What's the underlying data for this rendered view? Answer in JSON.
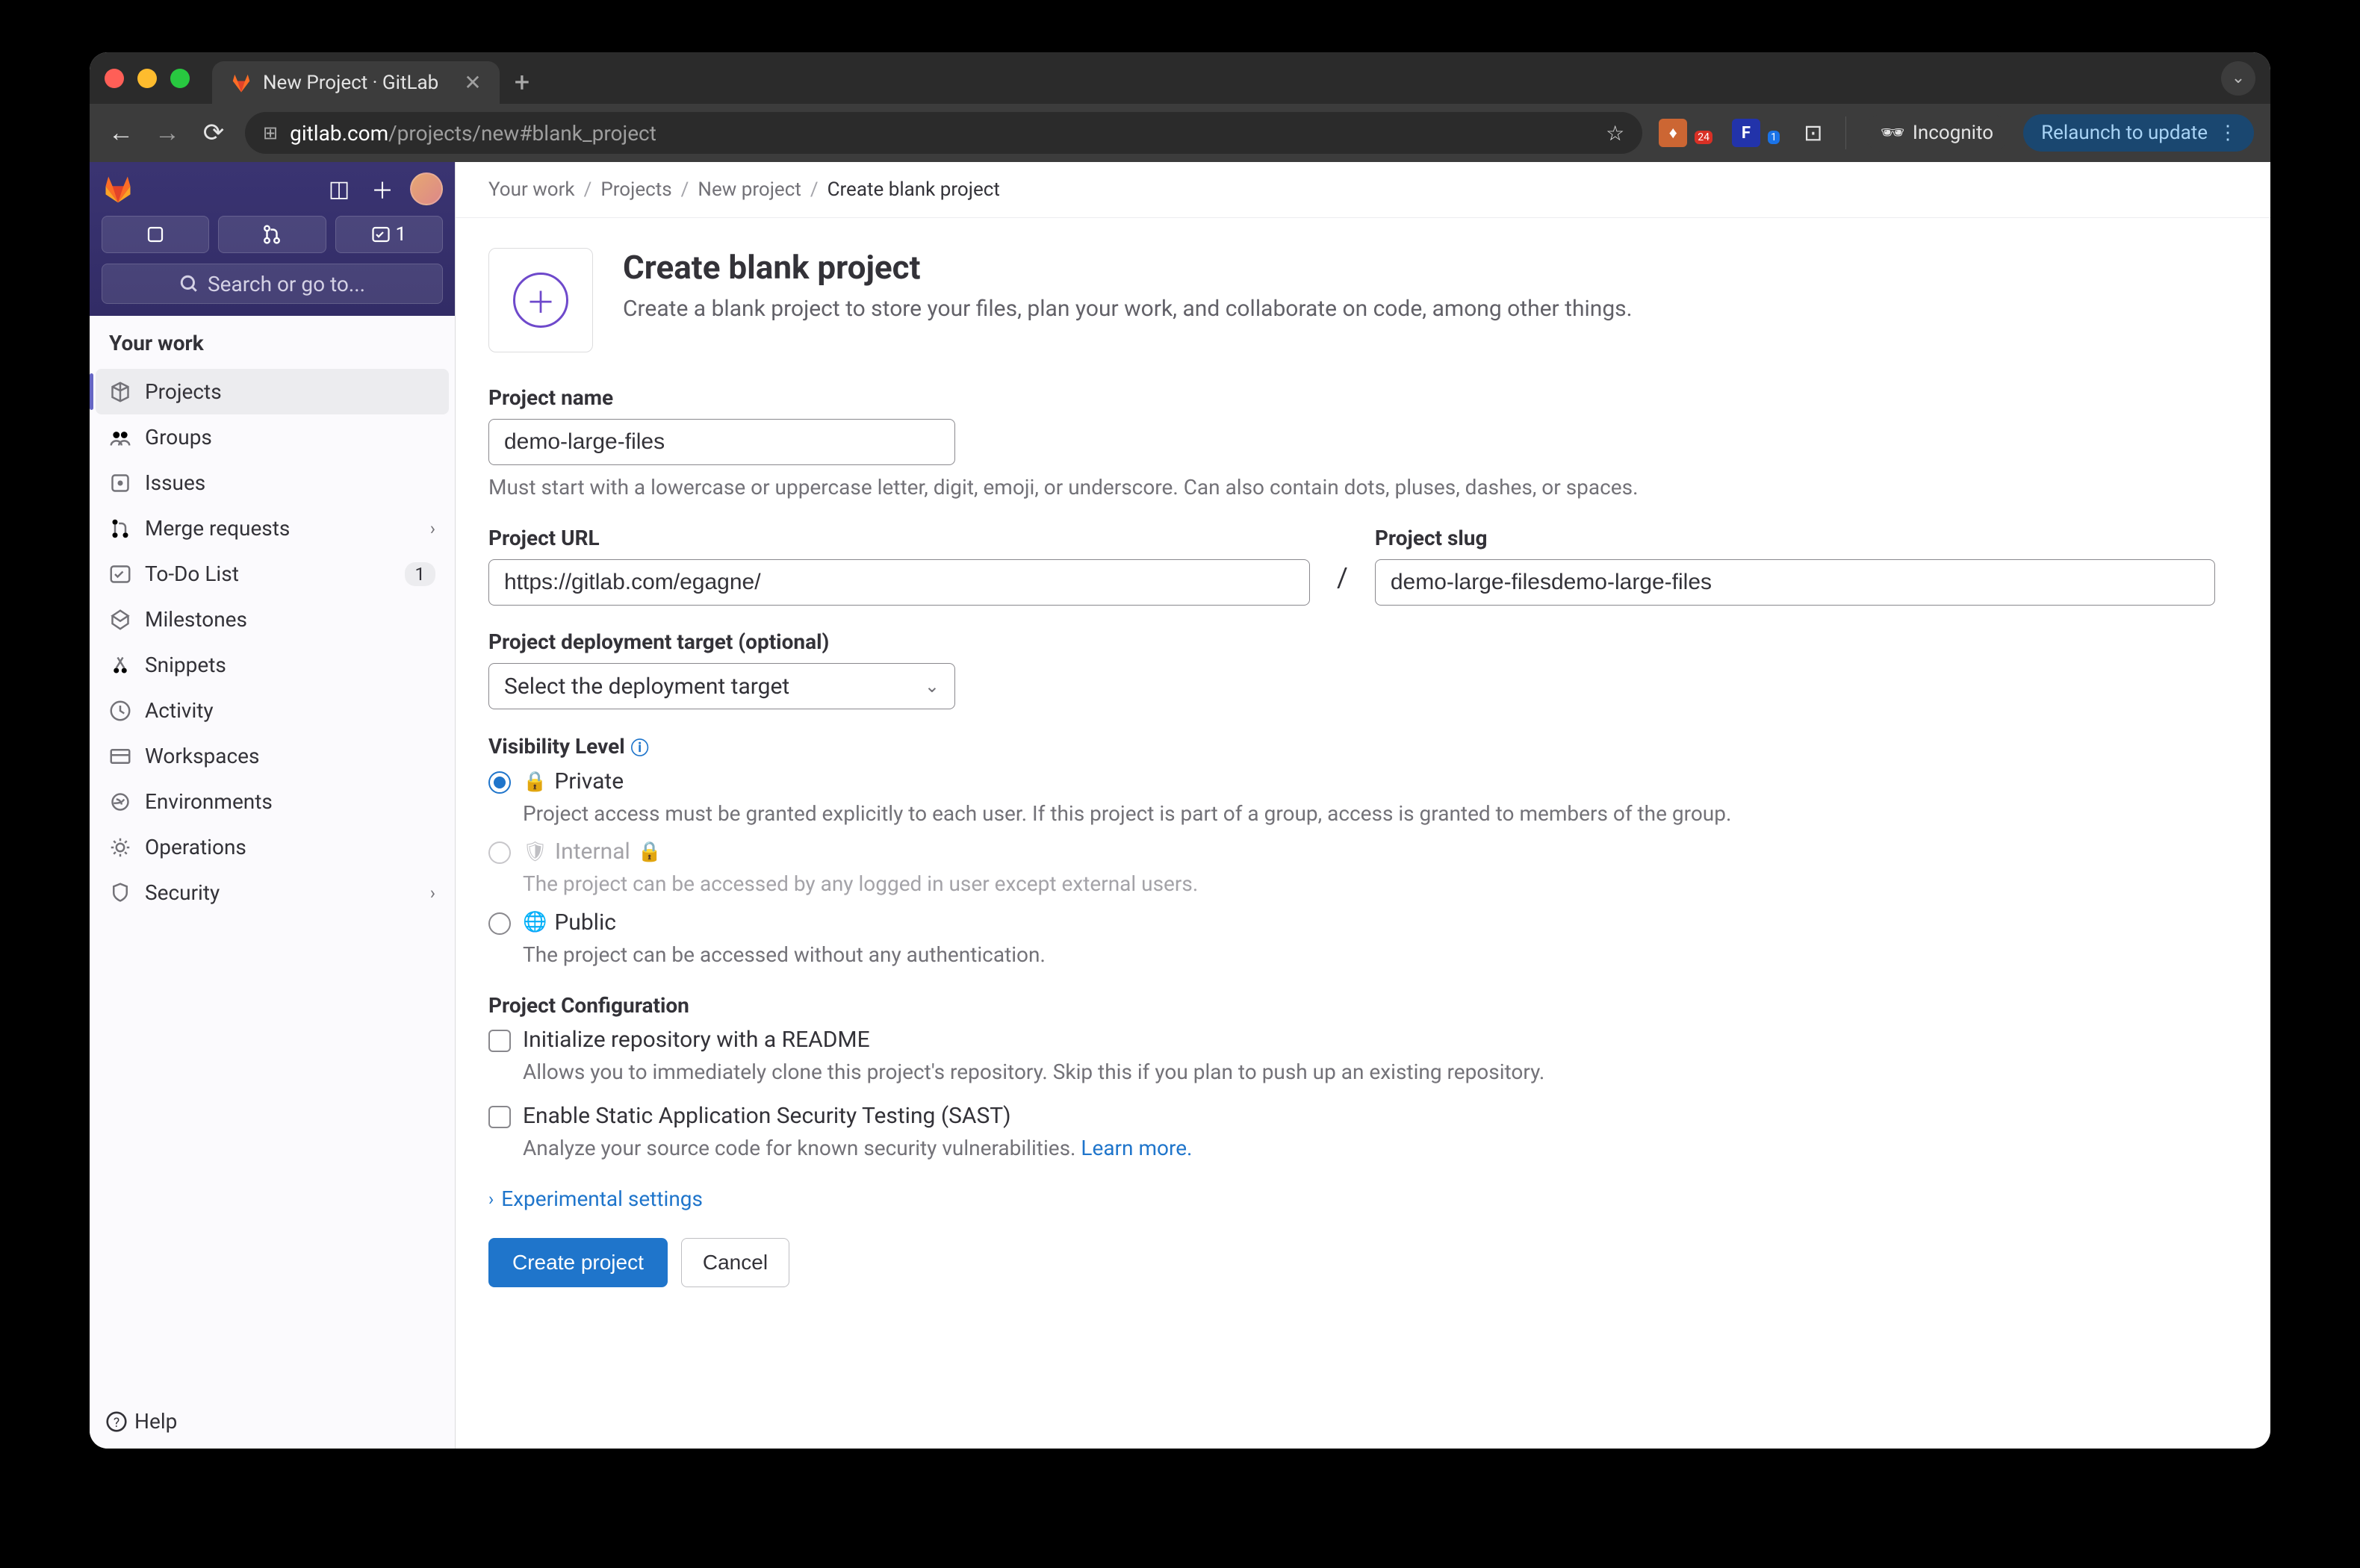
{
  "browser": {
    "tab_title": "New Project · GitLab",
    "url_domain": "gitlab.com",
    "url_path": "/projects/new#blank_project",
    "incognito_label": "Incognito",
    "relaunch_label": "Relaunch to update",
    "ext_badge_1": "24",
    "ext_badge_2": "1"
  },
  "sidebar": {
    "search_label": "Search or go to...",
    "section_title": "Your work",
    "action_todo_count": "1",
    "items": [
      {
        "icon": "cube",
        "label": "Projects",
        "active": true
      },
      {
        "icon": "group",
        "label": "Groups"
      },
      {
        "icon": "issues",
        "label": "Issues"
      },
      {
        "icon": "merge",
        "label": "Merge requests",
        "chevron": true
      },
      {
        "icon": "todo",
        "label": "To-Do List",
        "badge": "1"
      },
      {
        "icon": "milestone",
        "label": "Milestones"
      },
      {
        "icon": "snippet",
        "label": "Snippets"
      },
      {
        "icon": "activity",
        "label": "Activity"
      },
      {
        "icon": "workspace",
        "label": "Workspaces"
      },
      {
        "icon": "env",
        "label": "Environments"
      },
      {
        "icon": "ops",
        "label": "Operations"
      },
      {
        "icon": "security",
        "label": "Security",
        "chevron": true
      }
    ],
    "help_label": "Help"
  },
  "breadcrumbs": [
    {
      "label": "Your work"
    },
    {
      "label": "Projects"
    },
    {
      "label": "New project"
    },
    {
      "label": "Create blank project",
      "current": true
    }
  ],
  "hero": {
    "title": "Create blank project",
    "description": "Create a blank project to store your files, plan your work, and collaborate on code, among other things."
  },
  "form": {
    "name_label": "Project name",
    "name_value": "demo-large-files",
    "name_help": "Must start with a lowercase or uppercase letter, digit, emoji, or underscore. Can also contain dots, pluses, dashes, or spaces.",
    "url_label": "Project URL",
    "url_value": "https://gitlab.com/egagne/",
    "slug_label": "Project slug",
    "slug_value": "demo-large-filesdemo-large-files",
    "deploy_label": "Project deployment target (optional)",
    "deploy_placeholder": "Select the deployment target",
    "visibility_label": "Visibility Level",
    "visibility_options": [
      {
        "value": "private",
        "label": "Private",
        "icon": "lock",
        "desc": "Project access must be granted explicitly to each user. If this project is part of a group, access is granted to members of the group.",
        "checked": true
      },
      {
        "value": "internal",
        "label": "Internal",
        "icon": "shield",
        "desc": "The project can be accessed by any logged in user except external users.",
        "disabled": true,
        "trailing_lock": true
      },
      {
        "value": "public",
        "label": "Public",
        "icon": "globe",
        "desc": "The project can be accessed without any authentication."
      }
    ],
    "config_label": "Project Configuration",
    "readme_label": "Initialize repository with a README",
    "readme_desc": "Allows you to immediately clone this project's repository. Skip this if you plan to push up an existing repository.",
    "sast_label": "Enable Static Application Security Testing (SAST)",
    "sast_desc_text": "Analyze your source code for known security vulnerabilities. ",
    "sast_learn_more": "Learn more.",
    "experimental_label": "Experimental settings",
    "create_button": "Create project",
    "cancel_button": "Cancel"
  }
}
